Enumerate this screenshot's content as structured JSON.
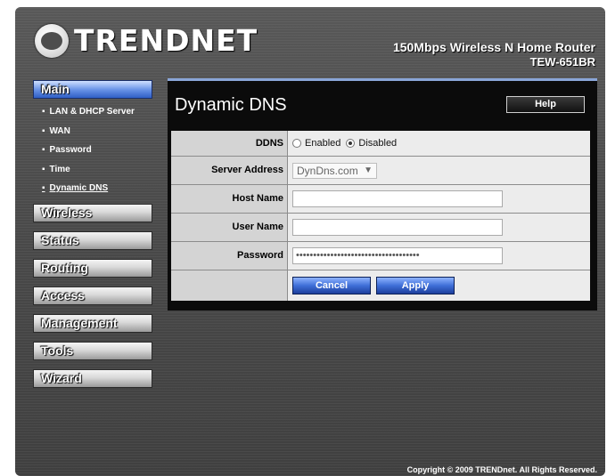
{
  "header": {
    "brand": "TRENDNET",
    "product_line": "150Mbps Wireless N Home Router",
    "model": "TEW-651BR"
  },
  "sidebar": {
    "main_label": "Main",
    "submenu": [
      {
        "label": "LAN & DHCP Server"
      },
      {
        "label": "WAN"
      },
      {
        "label": "Password"
      },
      {
        "label": "Time"
      },
      {
        "label": "Dynamic DNS"
      }
    ],
    "items": [
      {
        "label": "Wireless"
      },
      {
        "label": "Status"
      },
      {
        "label": "Routing"
      },
      {
        "label": "Access"
      },
      {
        "label": "Management"
      },
      {
        "label": "Tools"
      },
      {
        "label": "Wizard"
      }
    ]
  },
  "main": {
    "title": "Dynamic DNS",
    "help_label": "Help",
    "ddns": {
      "label": "DDNS",
      "option_enabled": "Enabled",
      "option_disabled": "Disabled",
      "selected": "Disabled"
    },
    "server_address": {
      "label": "Server Address",
      "value": "DynDns.com"
    },
    "host_name": {
      "label": "Host Name",
      "value": ""
    },
    "user_name": {
      "label": "User Name",
      "value": ""
    },
    "password": {
      "label": "Password",
      "value": "••••••••••••••••••••••••••••••••••••"
    },
    "cancel_label": "Cancel",
    "apply_label": "Apply"
  },
  "footer": {
    "copyright": "Copyright © 2009 TRENDnet. All Rights Reserved."
  },
  "colors": {
    "active_menu": "#4a78d8",
    "background": "#4b4b4b",
    "panel": "#0b0b0b"
  }
}
